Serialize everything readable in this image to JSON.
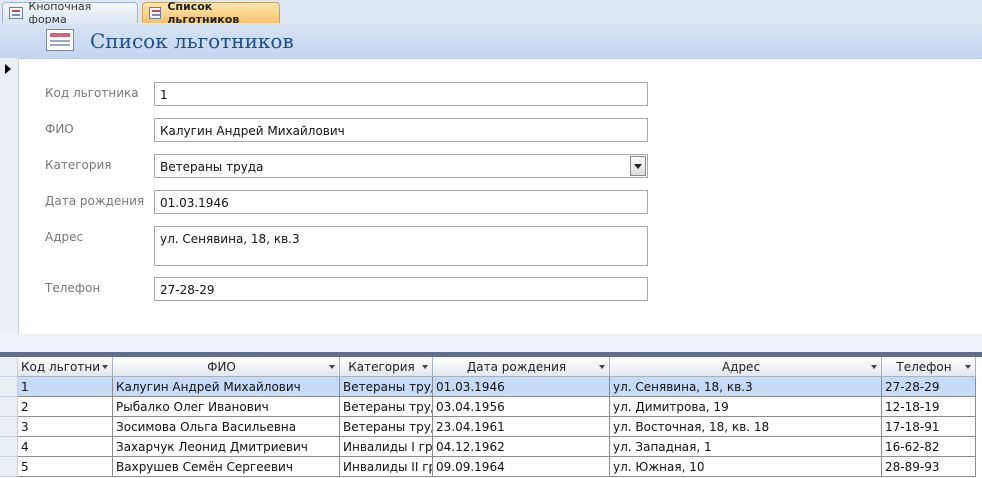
{
  "tabs": [
    {
      "label": "Кнопочная форма",
      "active": false
    },
    {
      "label": "Список льготников",
      "active": true
    }
  ],
  "form": {
    "title": "Список льготников",
    "fields": {
      "code": {
        "label": "Код льготника",
        "value": "1"
      },
      "fio": {
        "label": "ФИО",
        "value": "Калугин Андрей Михайлович"
      },
      "category": {
        "label": "Категория",
        "value": "Ветераны труда"
      },
      "birthdate": {
        "label": "Дата рождения",
        "value": "01.03.1946"
      },
      "address": {
        "label": "Адрес",
        "value": "ул. Сенявина, 18, кв.3"
      },
      "phone": {
        "label": "Телефон",
        "value": "27-28-29"
      }
    }
  },
  "datasheet": {
    "columns": [
      "Код льготни",
      "ФИО",
      "Категория",
      "Дата рождения",
      "Адрес",
      "Телефон"
    ],
    "rows": [
      [
        "1",
        "Калугин Андрей Михайлович",
        "Ветераны труда",
        "01.03.1946",
        "ул. Сенявина, 18, кв.3",
        "27-28-29"
      ],
      [
        "2",
        "Рыбалко Олег Иванович",
        "Ветераны труда",
        "03.04.1956",
        "ул. Димитрова, 19",
        "12-18-19"
      ],
      [
        "3",
        "Зосимова Ольга Васильевна",
        "Ветераны труда",
        "23.04.1961",
        "ул. Восточная, 18, кв. 18",
        "17-18-91"
      ],
      [
        "4",
        "Захарчук Леонид Дмитриевич",
        "Инвалиды I гр",
        "04.12.1962",
        "ул. Западная, 1",
        "16-62-82"
      ],
      [
        "5",
        "Вахрушев Семён Сергеевич",
        "Инвалиды II гр",
        "09.09.1964",
        "ул. Южная, 10",
        "28-89-93"
      ]
    ]
  },
  "colors": {
    "accent": "#1f4e8a",
    "tab_active": "#f6c36b",
    "selected_row": "#c6dbf8"
  }
}
